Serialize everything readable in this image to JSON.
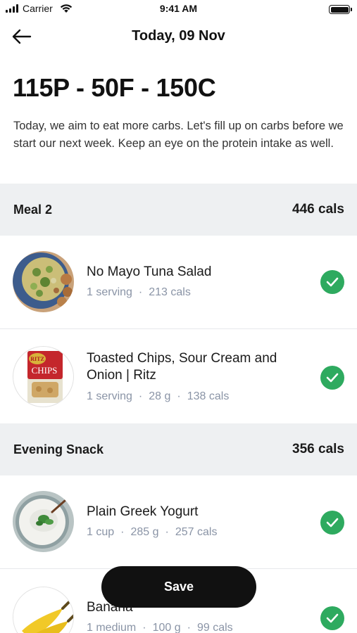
{
  "status_bar": {
    "carrier": "Carrier",
    "time": "9:41 AM"
  },
  "nav": {
    "title": "Today, 09 Nov"
  },
  "macros": {
    "heading": "115P - 50F - 150C"
  },
  "description": "Today, we aim to eat more carbs. Let's fill up on carbs before we start our next week. Keep an eye on the protein intake as well.",
  "meals": [
    {
      "title": "Meal 2",
      "cals": "446 cals",
      "items": [
        {
          "name": "No Mayo Tuna Salad",
          "serving": "1 serving",
          "weight": "",
          "cals": "213 cals",
          "checked": true,
          "image_icon": "salad-bowl"
        },
        {
          "name": "Toasted Chips, Sour Cream and Onion | Ritz",
          "serving": "1 serving",
          "weight": "28 g",
          "cals": "138 cals",
          "checked": true,
          "image_icon": "ritz-chips-box",
          "brand_text": "RITZ",
          "product_text": "CHIPS"
        }
      ]
    },
    {
      "title": "Evening Snack",
      "cals": "356 cals",
      "items": [
        {
          "name": "Plain Greek Yogurt",
          "serving": "1 cup",
          "weight": "285 g",
          "cals": "257 cals",
          "checked": true,
          "image_icon": "yogurt-bowl"
        },
        {
          "name": "Banana",
          "serving": "1 medium",
          "weight": "100 g",
          "cals": "99 cals",
          "checked": true,
          "image_icon": "banana"
        }
      ]
    }
  ],
  "save_label": "Save",
  "colors": {
    "accent_green": "#2eaa5f",
    "section_bg": "#eef0f2",
    "meta_text": "#8a94a6",
    "button_bg": "#111111"
  }
}
